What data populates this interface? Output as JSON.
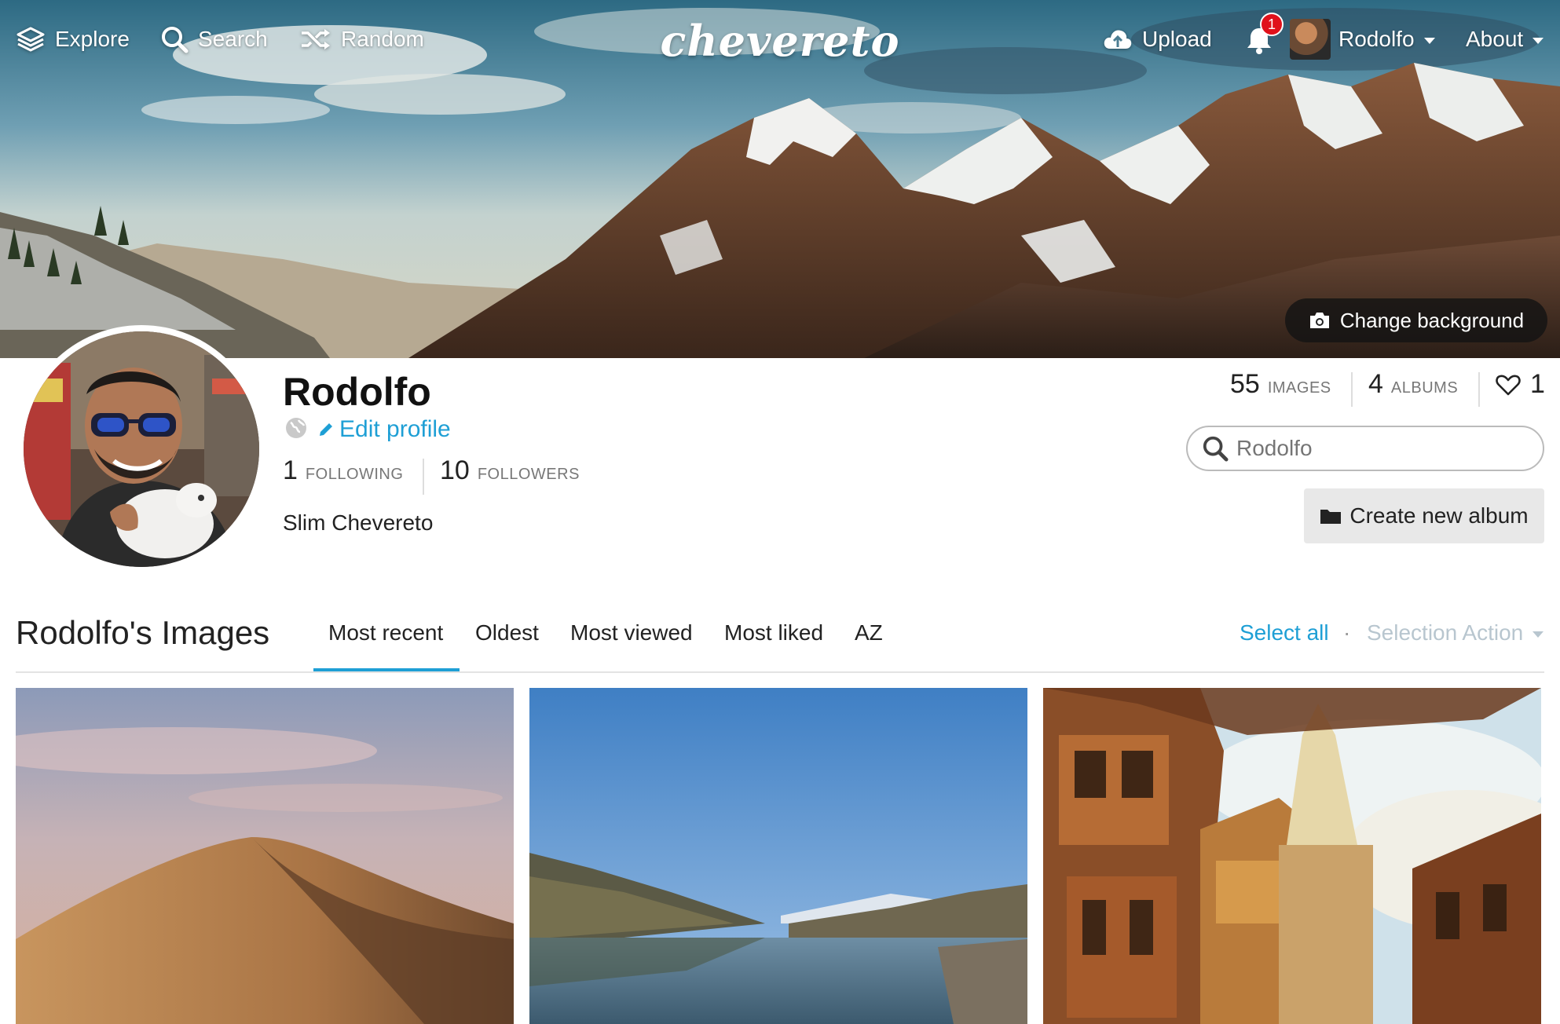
{
  "topbar": {
    "explore_label": "Explore",
    "search_label": "Search",
    "random_label": "Random",
    "logo_text": "chevereto",
    "upload_label": "Upload",
    "notification_count": "1",
    "user_label": "Rodolfo",
    "about_label": "About"
  },
  "hero": {
    "change_background_label": "Change background"
  },
  "profile": {
    "name": "Rodolfo",
    "edit_profile_label": "Edit profile",
    "following_count": "1",
    "following_label": "FOLLOWING",
    "followers_count": "10",
    "followers_label": "FOLLOWERS",
    "bio": "Slim Chevereto"
  },
  "stats": {
    "images_count": "55",
    "images_label": "IMAGES",
    "albums_count": "4",
    "albums_label": "ALBUMS",
    "likes_count": "1"
  },
  "user_search": {
    "placeholder": "Rodolfo"
  },
  "create_album_label": "Create new album",
  "listing": {
    "title": "Rodolfo's Images",
    "tabs": [
      "Most recent",
      "Oldest",
      "Most viewed",
      "Most liked",
      "AZ"
    ],
    "active_tab": "Most recent",
    "select_all_label": "Select all",
    "separator": "·",
    "selection_action_label": "Selection Action"
  },
  "images": [
    {
      "subject": "desert dune"
    },
    {
      "subject": "mountain lake"
    },
    {
      "subject": "fantasy town"
    }
  ],
  "colors": {
    "accent": "#1e9fd5",
    "badge": "#e0111b",
    "muted": "#b8c6cf"
  }
}
